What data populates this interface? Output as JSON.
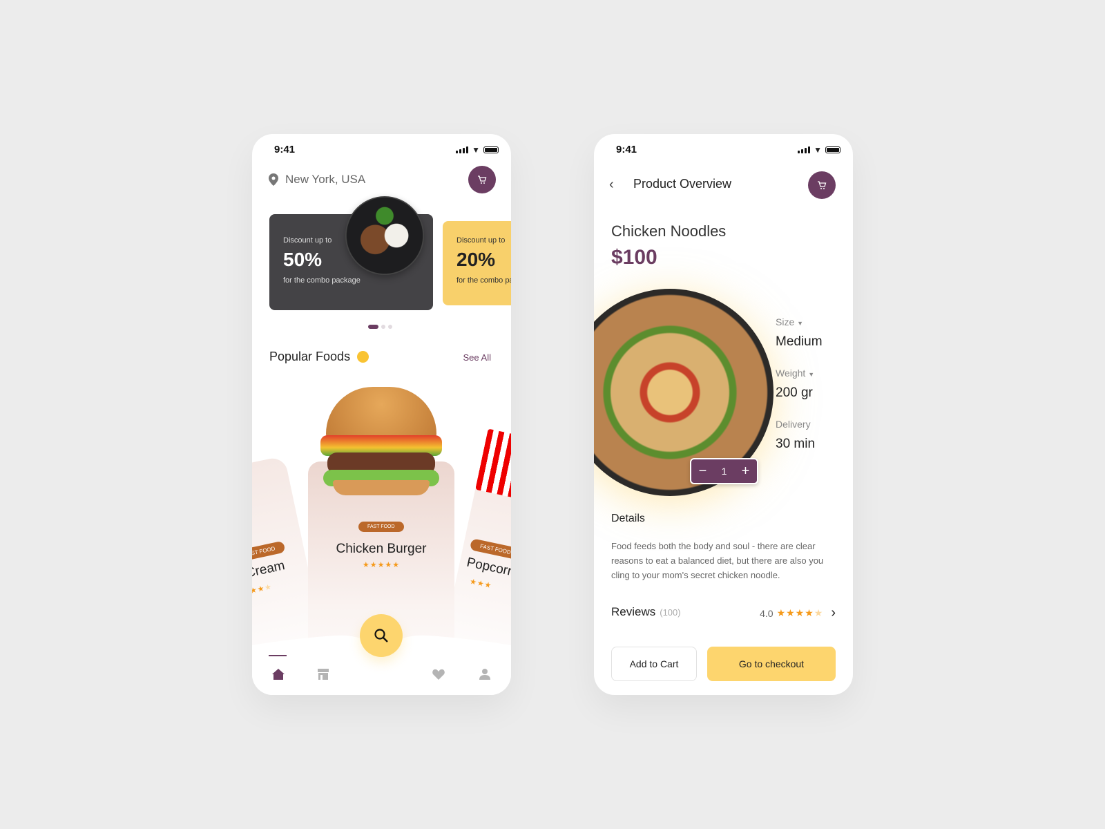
{
  "home": {
    "status": {
      "time": "9:41"
    },
    "location": "New York, USA",
    "promos": [
      {
        "title": "Discount up to",
        "percent": "50%",
        "subtitle": "for the combo package",
        "color": "#444346"
      },
      {
        "title": "Discount up to",
        "percent": "20%",
        "subtitle": "for the combo package",
        "color": "#f8d06b"
      }
    ],
    "carousel_active": 0,
    "section_title": "Popular Foods",
    "see_all": "See All",
    "foods": [
      {
        "badge": "FAST FOOD",
        "name": "Ice Cream",
        "rating": 3.5
      },
      {
        "badge": "FAST FOOD",
        "name": "Chicken Burger",
        "rating": 5
      },
      {
        "badge": "FAST FOOD",
        "name": "Popcorn",
        "rating": 4
      }
    ],
    "nav": [
      "home-icon",
      "store-icon",
      "heart-icon",
      "user-icon"
    ],
    "accent": "#6b3d62",
    "yellow": "#fdd56e",
    "badge_color": "#bb682a"
  },
  "product": {
    "status": {
      "time": "9:41"
    },
    "header_title": "Product Overview",
    "name": "Chicken Noodles",
    "price": "$100",
    "size_label": "Size",
    "size_value": "Medium",
    "weight_label": "Weight",
    "weight_value": "200 gr",
    "delivery_label": "Delivery",
    "delivery_value": "30 min",
    "quantity": "1",
    "details_title": "Details",
    "details_text": "Food feeds both the body and soul - there are clear reasons to eat a balanced diet, but there are also  you cling to your mom's secret chicken noodle.",
    "reviews_label": "Reviews",
    "reviews_count": "(100)",
    "rating": "4.0",
    "add_to_cart": "Add to Cart",
    "checkout": "Go to checkout"
  }
}
